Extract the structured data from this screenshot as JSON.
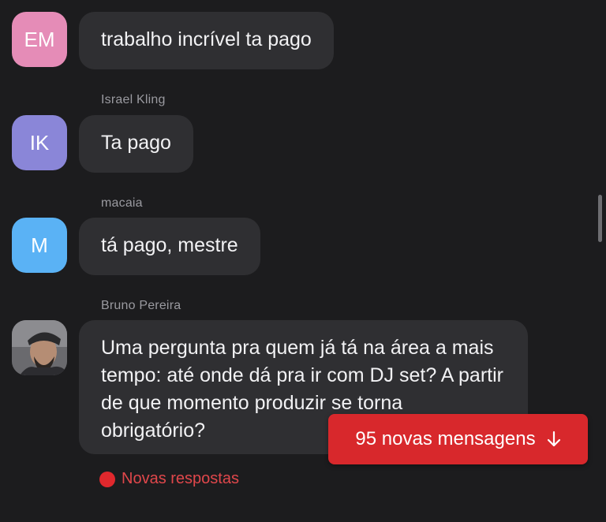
{
  "messages": [
    {
      "initials": "EM",
      "sender": "",
      "text": "trabalho incrível ta pago",
      "avatar_color": "#e58cb7"
    },
    {
      "initials": "IK",
      "sender": "Israel Kling",
      "text": "Ta pago",
      "avatar_color": "#8a86d8"
    },
    {
      "initials": "M",
      "sender": "macaia",
      "text": "tá pago, mestre",
      "avatar_color": "#5ab2f5"
    },
    {
      "initials": "",
      "sender": "Bruno Pereira",
      "text": "Uma pergunta pra quem já tá na área a mais tempo: até onde dá pra ir com DJ set? A partir de que momento produzir se torna obrigatório?",
      "avatar_color": "#4a4a4e"
    }
  ],
  "new_messages_button": {
    "label": "95 novas mensagens",
    "icon": "arrow-down-icon",
    "color": "#d8282c"
  },
  "new_replies": {
    "label": "Novas respostas",
    "color": "#e0474b"
  },
  "colors": {
    "background": "#1c1c1e",
    "bubble": "#2f2f32",
    "sender_name": "#9a9aa0"
  }
}
